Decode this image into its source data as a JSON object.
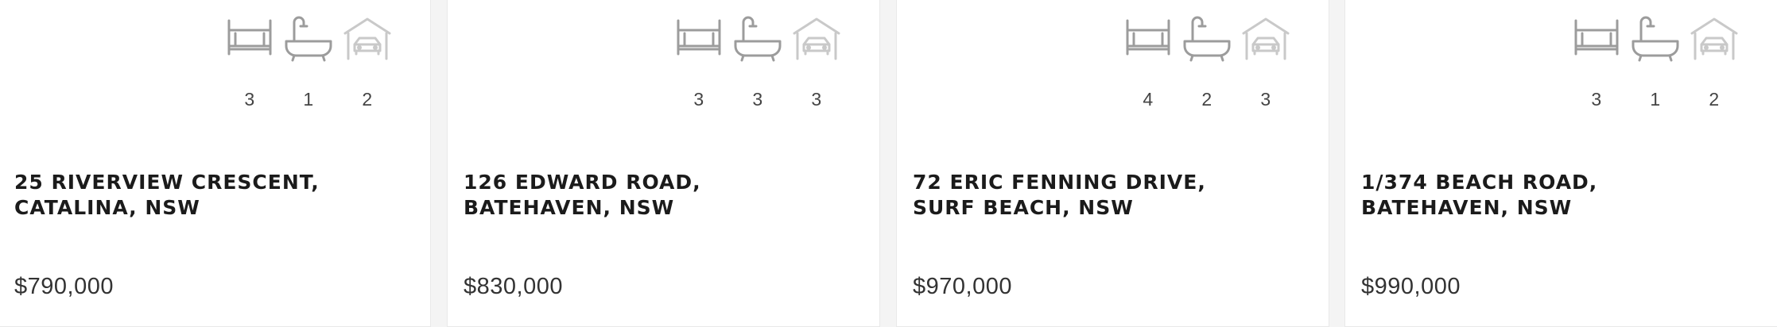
{
  "listings": [
    {
      "address_line1": "25 RIVERVIEW CRESCENT,",
      "address_line2": "CATALINA, NSW",
      "price": "$790,000",
      "features": [
        {
          "icon": "bed-icon",
          "count": "3"
        },
        {
          "icon": "bath-icon",
          "count": "1"
        },
        {
          "icon": "garage-icon",
          "count": "2"
        }
      ]
    },
    {
      "address_line1": "126 EDWARD ROAD,",
      "address_line2": "BATEHAVEN, NSW",
      "price": "$830,000",
      "features": [
        {
          "icon": "bed-icon",
          "count": "3"
        },
        {
          "icon": "bath-icon",
          "count": "3"
        },
        {
          "icon": "garage-icon",
          "count": "3"
        }
      ]
    },
    {
      "address_line1": "72 ERIC FENNING DRIVE,",
      "address_line2": "SURF BEACH, NSW",
      "price": "$970,000",
      "features": [
        {
          "icon": "bed-icon",
          "count": "4"
        },
        {
          "icon": "bath-icon",
          "count": "2"
        },
        {
          "icon": "garage-icon",
          "count": "3"
        }
      ]
    },
    {
      "address_line1": "1/374 BEACH ROAD,",
      "address_line2": "BATEHAVEN, NSW",
      "price": "$990,000",
      "features": [
        {
          "icon": "bed-icon",
          "count": "3"
        },
        {
          "icon": "bath-icon",
          "count": "1"
        },
        {
          "icon": "garage-icon",
          "count": "2"
        }
      ]
    }
  ],
  "colors": {
    "card_background": "#ffffff",
    "page_background": "#f4f4f4",
    "icon_stroke": "#9c9c9c",
    "garage_icon_stroke": "#c9c9c9",
    "address_text": "#1b1b1b",
    "price_text": "#333333"
  }
}
